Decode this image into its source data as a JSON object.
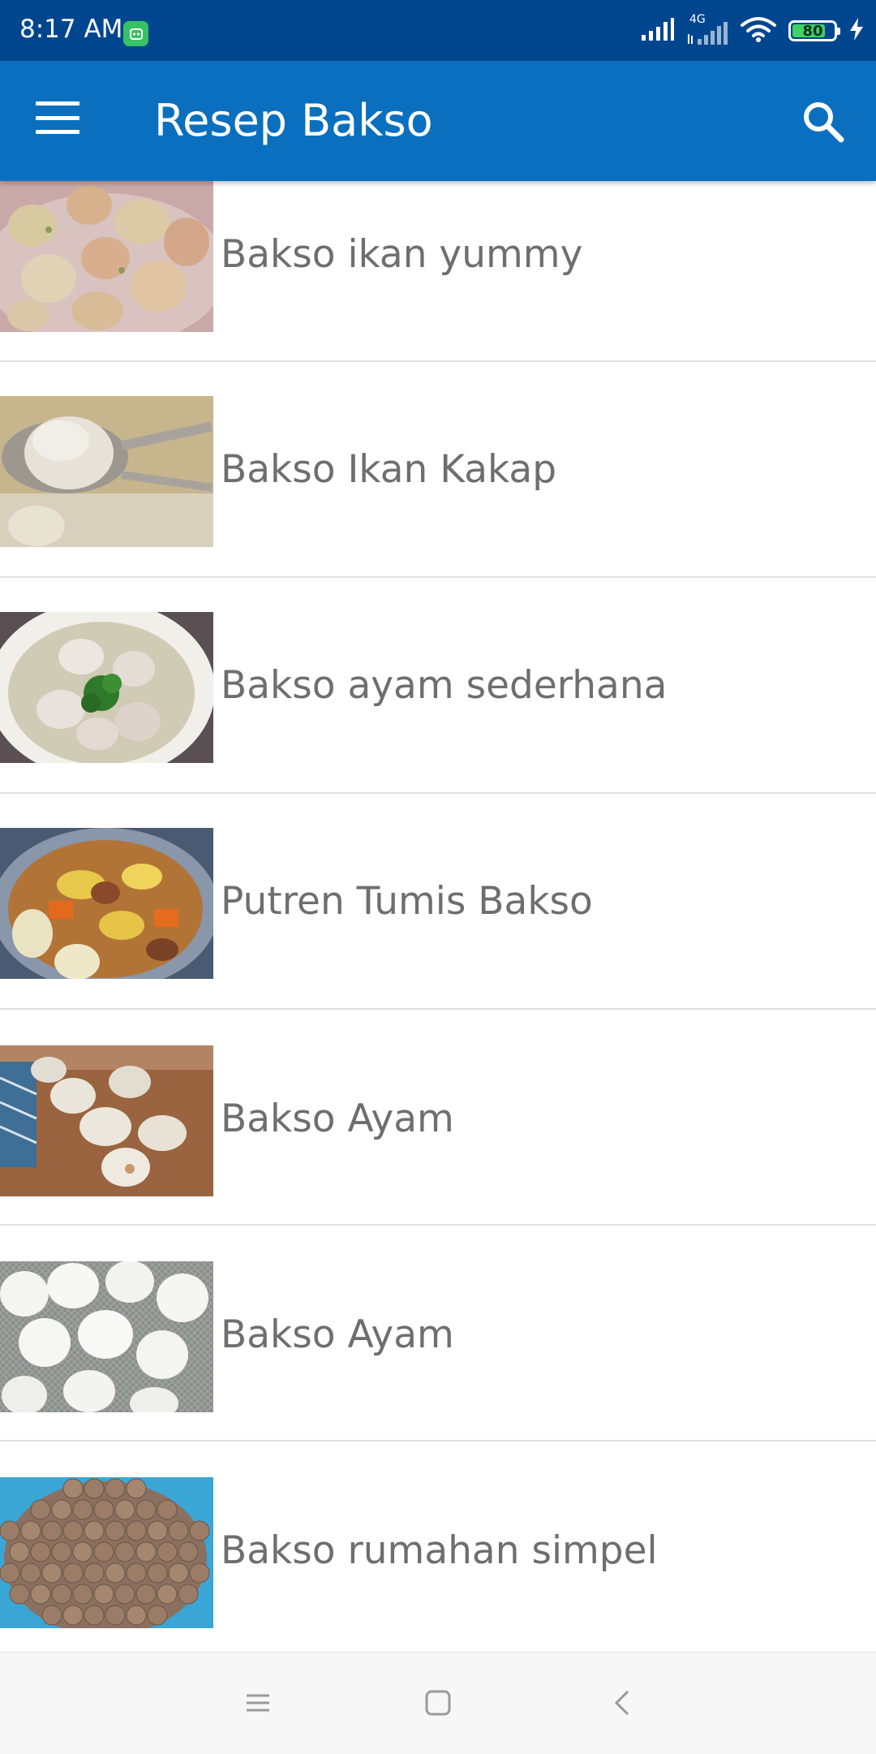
{
  "status_bar": {
    "time": "8:17 AM",
    "network_type": "4G",
    "battery_level": "80",
    "icons": [
      "app-notification-icon",
      "signal-icon",
      "signal-4g-icon",
      "wifi-icon",
      "battery-icon",
      "charging-icon"
    ]
  },
  "app_bar": {
    "title": "Resep Bakso",
    "menu_icon": "hamburger-menu-icon",
    "search_icon": "search-icon"
  },
  "recipes": [
    {
      "title": "Bakso ikan yummy",
      "image": "fish-meatballs-photo"
    },
    {
      "title": "Bakso Ikan Kakap",
      "image": "snapper-meatball-spoon-photo"
    },
    {
      "title": "Bakso ayam sederhana",
      "image": "chicken-meatball-soup-photo"
    },
    {
      "title": "Putren Tumis Bakso",
      "image": "stir-fry-meatball-photo"
    },
    {
      "title": "Bakso Ayam",
      "image": "chicken-meatballs-board-photo"
    },
    {
      "title": "Bakso Ayam",
      "image": "white-chicken-meatballs-photo"
    },
    {
      "title": "Bakso rumahan simpel",
      "image": "homemade-meatballs-bowl-photo"
    }
  ],
  "nav_bar": {
    "icons": [
      "recent-apps-icon",
      "home-icon",
      "back-icon"
    ]
  },
  "colors": {
    "status_bar": "#00468f",
    "app_bar": "#0a6fbe",
    "item_text": "#6e6e6e",
    "nav_bar": "#f7f7f7"
  }
}
